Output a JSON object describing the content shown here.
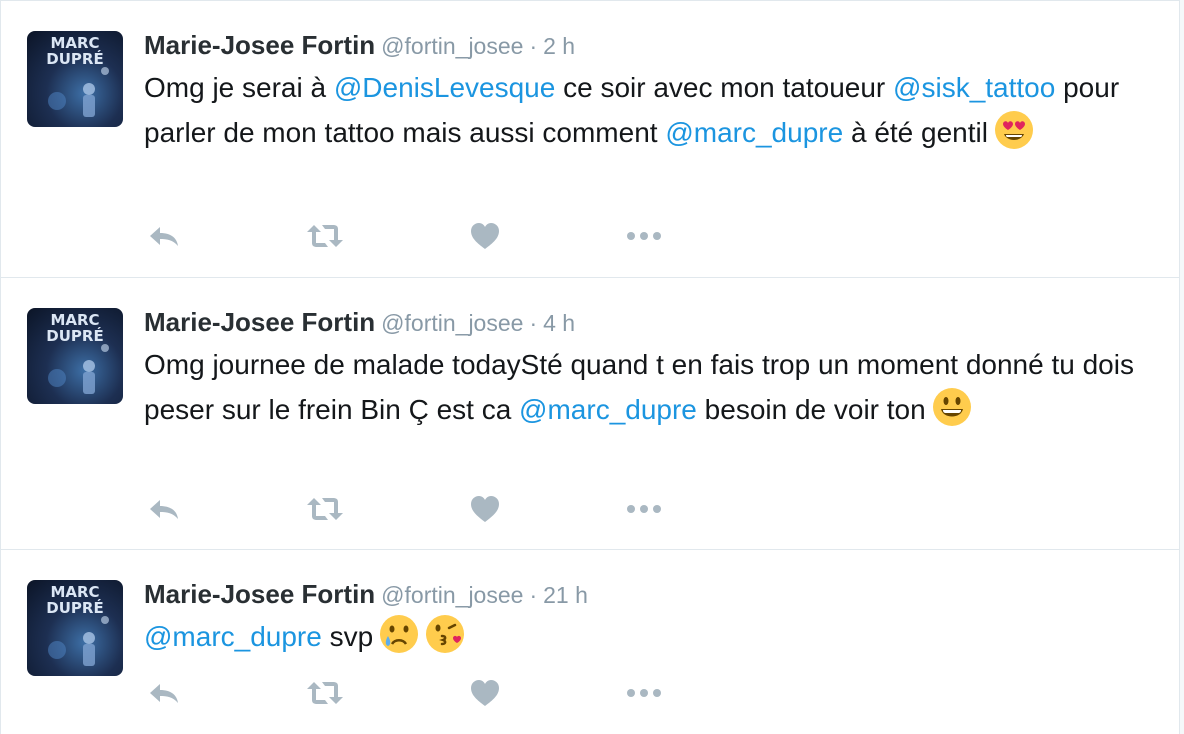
{
  "tweets": [
    {
      "author_name": "Marie-Josee Fortin",
      "handle": "@fortin_josee",
      "separator": "·",
      "time": "2 h",
      "avatar_text": [
        "MARC",
        "DUPRÉ"
      ],
      "parts": [
        {
          "t": "Omg je serai à "
        },
        {
          "m": "@DenisLevesque"
        },
        {
          "t": " ce soir avec mon tatoueur "
        },
        {
          "m": "@sisk_tattoo"
        },
        {
          "t": " pour parler de mon tattoo mais aussi comment "
        },
        {
          "m": "@marc_dupre"
        },
        {
          "t": " à été gentil"
        }
      ],
      "emojis": [
        "heart-eyes"
      ]
    },
    {
      "author_name": "Marie-Josee Fortin",
      "handle": "@fortin_josee",
      "separator": "·",
      "time": "4 h",
      "avatar_text": [
        "MARC",
        "DUPRÉ"
      ],
      "parts": [
        {
          "t": "Omg journee de malade todaySté quand t en fais trop un moment donné tu dois peser sur le frein Bin Ç est ca "
        },
        {
          "m": "@marc_dupre"
        },
        {
          "t": " besoin de voir ton"
        }
      ],
      "emojis": [
        "grinning"
      ]
    },
    {
      "author_name": "Marie-Josee Fortin",
      "handle": "@fortin_josee",
      "separator": "·",
      "time": "21 h",
      "avatar_text": [
        "MARC",
        "DUPRÉ"
      ],
      "parts": [
        {
          "m": "@marc_dupre"
        },
        {
          "t": " svp"
        }
      ],
      "emojis": [
        "crying",
        "kissing-heart"
      ]
    }
  ],
  "colors": {
    "mention": "#1b95e0",
    "action_icon": "#aab8c2",
    "meta": "#8899a6",
    "border": "#e1e8ed"
  },
  "icons": [
    "reply-icon",
    "retweet-icon",
    "like-icon",
    "more-icon"
  ]
}
